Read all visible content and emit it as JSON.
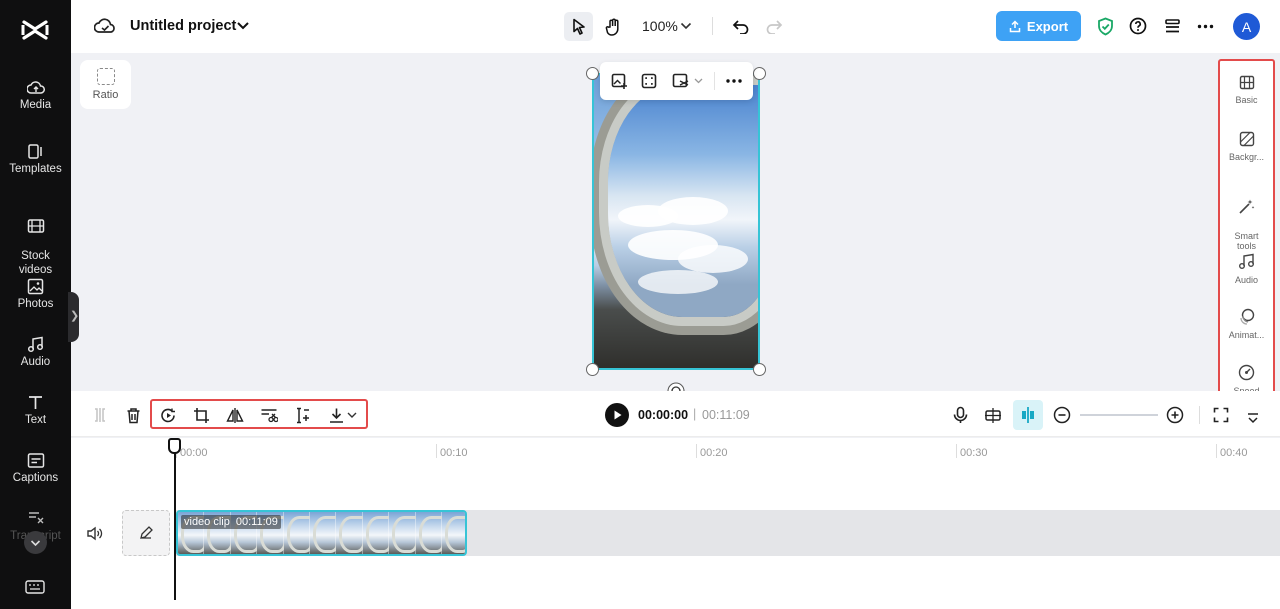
{
  "sidebar": {
    "items": [
      {
        "label": "Media",
        "icon": "cloud-upload-icon"
      },
      {
        "label": "Templates",
        "icon": "templates-icon"
      },
      {
        "label": "Stock\nvideos",
        "icon": "film-icon"
      },
      {
        "label": "Photos",
        "icon": "image-icon"
      },
      {
        "label": "Audio",
        "icon": "music-note-icon"
      },
      {
        "label": "Text",
        "icon": "text-t-icon"
      },
      {
        "label": "Captions",
        "icon": "captions-icon"
      },
      {
        "label": "Transcript",
        "icon": "transcript-icon"
      }
    ]
  },
  "topbar": {
    "project_title": "Untitled project",
    "zoom_level": "100%",
    "export_label": "Export"
  },
  "avatar": {
    "initial": "A"
  },
  "canvas": {
    "ratio_label": "Ratio"
  },
  "right_panel": {
    "items": [
      {
        "label": "Basic",
        "icon": "basic-icon"
      },
      {
        "label": "Backgr...",
        "icon": "background-icon"
      },
      {
        "label": "Smart\ntools",
        "icon": "magic-wand-icon"
      },
      {
        "label": "Audio",
        "icon": "music-note-icon"
      },
      {
        "label": "Animat...",
        "icon": "animation-icon"
      },
      {
        "label": "Speed",
        "icon": "speed-icon"
      }
    ]
  },
  "player": {
    "current_time": "00:00:00",
    "separator": "|",
    "total_time": "00:11:09"
  },
  "timeline": {
    "ruler": [
      "00:00",
      "00:10",
      "00:20",
      "00:30",
      "00:40"
    ],
    "clip": {
      "name": "video clip",
      "duration": "00:11:09"
    }
  },
  "colors": {
    "accent": "#3ea2f5",
    "selection": "#36c4d6",
    "highlight_box": "#e34b4b",
    "sidebar_bg": "#0f0f10"
  }
}
